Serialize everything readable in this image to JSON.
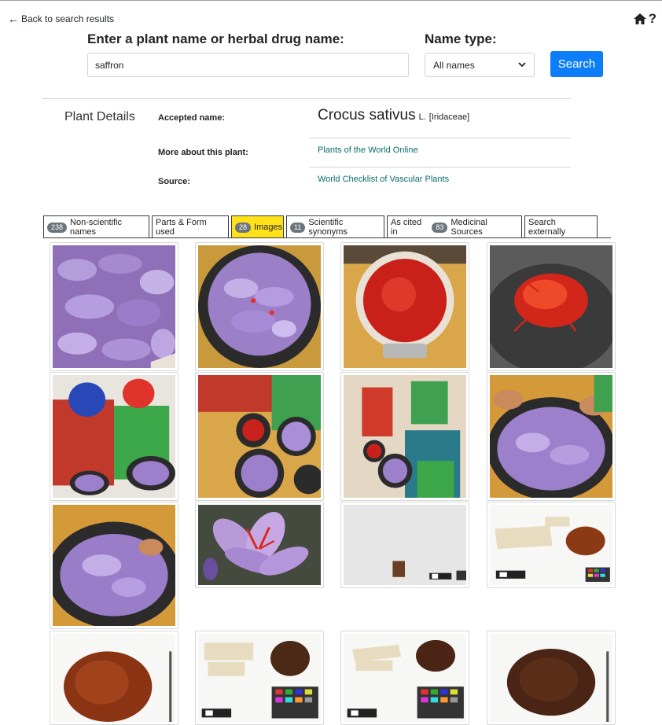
{
  "nav": {
    "back_label": "Back to search results"
  },
  "search": {
    "label": "Enter a plant name or herbal drug name:",
    "value": "saffron",
    "name_type_label": "Name type:",
    "name_type_value": "All names",
    "button_label": "Search"
  },
  "details": {
    "title": "Plant Details",
    "accepted_label": "Accepted name:",
    "scientific_name": "Crocus sativus",
    "authority": "L.",
    "family": "[Iridaceae]",
    "more_label": "More about this plant:",
    "more_link": "Plants of the World Online",
    "source_label": "Source:",
    "source_link": "World Checklist of Vascular Plants"
  },
  "tabs": [
    {
      "badge": "238",
      "label": "Non-scientific names"
    },
    {
      "badge": "",
      "label": "Parts & Form used"
    },
    {
      "badge": "28",
      "label": "Images"
    },
    {
      "badge": "11",
      "label": "Scientific synonyms"
    },
    {
      "label_pre": "As cited in",
      "badge": "83",
      "label": "Medicinal Sources"
    },
    {
      "badge": "",
      "label": "Search externally"
    }
  ],
  "active_tab": "Images",
  "colors": {
    "search_button": "#0d7ef8",
    "active_tab": "#ffe11a",
    "link": "#0b6b6b",
    "badge": "#6c757d"
  },
  "icons": [
    "back-arrow-icon",
    "home-icon",
    "help-icon",
    "chevron-down-icon"
  ]
}
